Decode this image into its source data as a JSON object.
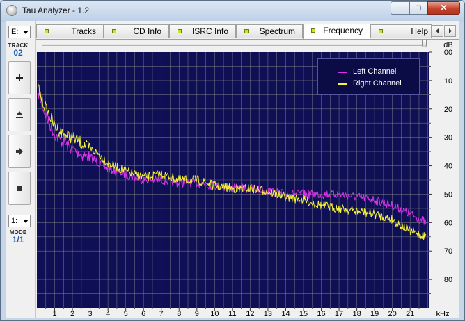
{
  "window": {
    "title": "Tau Analyzer - 1.2",
    "controls": {
      "minimize": "─",
      "maximize": "□",
      "close": "✕"
    }
  },
  "left_panel": {
    "drive_combo": "E:",
    "track_label": "TRACK",
    "track_value": "02",
    "mode_combo": "1:",
    "mode_label": "MODE",
    "mode_value": "1/1",
    "buttons": [
      {
        "name": "add-button",
        "icon": "plus-icon"
      },
      {
        "name": "eject-button",
        "icon": "eject-icon"
      },
      {
        "name": "forward-button",
        "icon": "arrow-right-icon"
      },
      {
        "name": "stop-button",
        "icon": "stop-icon"
      }
    ]
  },
  "tabs": [
    {
      "label": "Tracks",
      "active": false
    },
    {
      "label": "CD Info",
      "active": false
    },
    {
      "label": "ISRC Info",
      "active": false
    },
    {
      "label": "Spectrum",
      "active": false
    },
    {
      "label": "Frequency",
      "active": true
    },
    {
      "label": "Help",
      "active": false
    }
  ],
  "slider": {
    "value": 1.0
  },
  "colors": {
    "plot_bg": "#0f0f55",
    "grid": "#8e8e8e",
    "left_channel": "#d733e6",
    "right_channel": "#f2f238",
    "led": "#c9e61e"
  },
  "chart_data": {
    "type": "line",
    "xlabel": "kHz",
    "ylabel": "dB",
    "xlim": [
      0,
      22.05
    ],
    "ylim": [
      0,
      90
    ],
    "y_inverted": true,
    "x_ticks": [
      "1",
      "2",
      "3",
      "4",
      "5",
      "6",
      "7",
      "8",
      "9",
      "10",
      "11",
      "12",
      "13",
      "14",
      "15",
      "16",
      "17",
      "18",
      "19",
      "20",
      "21"
    ],
    "y_ticks": [
      "00",
      "10",
      "20",
      "30",
      "40",
      "50",
      "60",
      "70",
      "80"
    ],
    "grid": true,
    "legend_position": "top-right",
    "series": [
      {
        "name": "Left Channel",
        "color": "#d733e6",
        "x": [
          0.05,
          0.3,
          0.6,
          1.0,
          1.5,
          2.0,
          2.5,
          3.0,
          3.5,
          4.0,
          5.0,
          6.0,
          7.0,
          8.0,
          9.0,
          10.0,
          11.0,
          12.0,
          13.0,
          14.0,
          15.0,
          16.0,
          17.0,
          18.0,
          19.0,
          20.0,
          21.0,
          21.9
        ],
        "y": [
          14,
          19,
          24,
          29,
          32,
          34,
          36,
          37,
          39,
          41,
          43,
          45,
          45,
          46,
          46,
          47,
          48,
          48,
          49,
          50,
          50,
          50,
          50,
          51,
          52,
          54,
          57,
          60
        ]
      },
      {
        "name": "Right Channel",
        "color": "#f2f238",
        "x": [
          0.05,
          0.3,
          0.6,
          1.0,
          1.5,
          2.0,
          2.5,
          3.0,
          3.5,
          4.0,
          5.0,
          6.0,
          7.0,
          8.0,
          9.0,
          10.0,
          11.0,
          12.0,
          13.0,
          14.0,
          15.0,
          16.0,
          17.0,
          18.0,
          19.0,
          20.0,
          21.0,
          21.9
        ],
        "y": [
          12,
          17,
          21,
          26,
          29,
          30,
          32,
          34,
          36,
          39,
          42,
          44,
          43,
          45,
          45,
          47,
          48,
          48,
          49,
          51,
          52,
          54,
          55,
          56,
          57,
          59,
          63,
          65
        ]
      }
    ]
  }
}
